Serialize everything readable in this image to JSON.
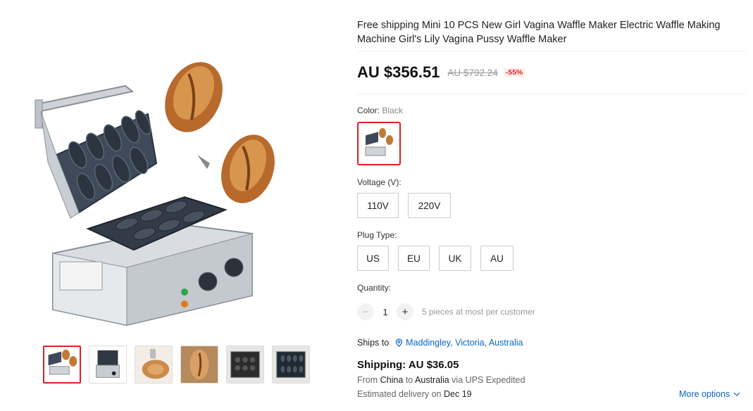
{
  "product": {
    "title": "Free shipping Mini 10 PCS New Girl Vagina Waffle Maker Electric Waffle Making Machine Girl's Lily Vagina Pussy Waffle Maker",
    "price": "AU $356.51",
    "original_price": "AU $792.24",
    "discount": "-55%"
  },
  "gallery": {
    "main_image_icon": "waffle-maker-photo",
    "thumbnails": [
      {
        "icon": "waffle-maker-with-waffles",
        "active": true
      },
      {
        "icon": "waffle-maker-open",
        "active": false
      },
      {
        "icon": "waffle-closeup",
        "active": false
      },
      {
        "icon": "waffle-single",
        "active": false
      },
      {
        "icon": "waffle-maker-in-case",
        "active": false
      },
      {
        "icon": "waffle-maker-in-case-alt",
        "active": false
      }
    ]
  },
  "color": {
    "label": "Color:",
    "selected": "Black"
  },
  "voltage": {
    "label": "Voltage (V):",
    "options": [
      "110V",
      "220V"
    ]
  },
  "plug": {
    "label": "Plug Type:",
    "options": [
      "US",
      "EU",
      "UK",
      "AU"
    ]
  },
  "quantity": {
    "label": "Quantity:",
    "minus": "−",
    "value": "1",
    "plus": "+",
    "note": "5 pieces at most per customer"
  },
  "shipping": {
    "ships_to_label": "Ships to",
    "location": "Maddingley, Victoria, Australia",
    "cost": "Shipping: AU $36.05",
    "from_label": "From",
    "from_country": "China",
    "to_label": "to",
    "to_country": "Australia",
    "via_label": "via UPS Expedited",
    "delivery_label": "Estimated delivery on",
    "delivery_date": "Dec 19",
    "more_options": "More options"
  },
  "colors": {
    "accent_red": "#e02020",
    "link_blue": "#0a66c2"
  }
}
